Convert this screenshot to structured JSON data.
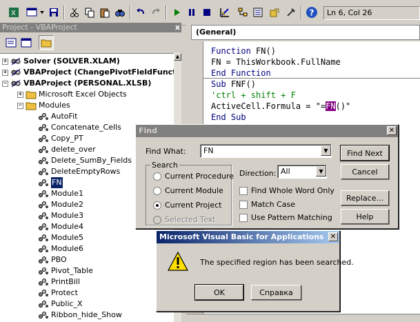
{
  "toolbar": {
    "status": "Ln 6, Col 26"
  },
  "project": {
    "title": "Project - VBAProject",
    "close": "x",
    "tree": [
      {
        "label": "Solver (SOLVER.XLAM)",
        "bold": true,
        "level": 0
      },
      {
        "label": "VBAProject (ChangePivotFieldFunctio",
        "bold": true,
        "level": 0
      },
      {
        "label": "VBAProject (PERSONAL.XLSB)",
        "bold": true,
        "level": 0
      },
      {
        "label": "Microsoft Excel Objects",
        "level": 1
      },
      {
        "label": "Modules",
        "level": 1
      },
      {
        "label": "AutoFit",
        "level": 2
      },
      {
        "label": "Concatenate_Cells",
        "level": 2
      },
      {
        "label": "Copy_PT",
        "level": 2
      },
      {
        "label": "delete_over",
        "level": 2
      },
      {
        "label": "Delete_SumBy_Fields",
        "level": 2
      },
      {
        "label": "DeleteEmptyRows",
        "level": 2
      },
      {
        "label": "FN",
        "level": 2,
        "selected": true
      },
      {
        "label": "Module1",
        "level": 2
      },
      {
        "label": "Module2",
        "level": 2
      },
      {
        "label": "Module3",
        "level": 2
      },
      {
        "label": "Module4",
        "level": 2
      },
      {
        "label": "Module5",
        "level": 2
      },
      {
        "label": "Module6",
        "level": 2
      },
      {
        "label": "PBO",
        "level": 2
      },
      {
        "label": "Pivot_Table",
        "level": 2
      },
      {
        "label": "PrintBill",
        "level": 2
      },
      {
        "label": "Protect",
        "level": 2
      },
      {
        "label": "Public_X",
        "level": 2
      },
      {
        "label": "Ribbon_hide_Show",
        "level": 2
      }
    ]
  },
  "code": {
    "combo": "(General)",
    "line1_kw": "Function",
    "line1_rest": " FN()",
    "line2": "FN = ThisWorkbook.FullName",
    "line3": "End Function",
    "line4_kw": "Sub",
    "line4_rest": " FNF()",
    "line5": "'ctrl + shift + F",
    "line6_pre": "ActiveCell.Formula = \"=",
    "line6_hl": "FN",
    "line6_post": "()\"",
    "line7": "End Sub"
  },
  "find": {
    "title": "Find",
    "find_what_label": "Find What:",
    "find_what_value": "FN",
    "search_label": "Search",
    "opt_current_procedure": "Current Procedure",
    "opt_current_module": "Current Module",
    "opt_current_project": "Current Project",
    "opt_selected_text": "Selected Text",
    "direction_label": "Direction:",
    "direction_value": "All",
    "chk_whole_word": "Find Whole Word Only",
    "chk_match_case": "Match Case",
    "chk_pattern": "Use Pattern Matching",
    "btn_find_next": "Find Next",
    "btn_cancel": "Cancel",
    "btn_replace": "Replace...",
    "btn_help": "Help"
  },
  "msgbox": {
    "title": "Microsoft Visual Basic for Applications",
    "message": "The specified region has been searched.",
    "ok": "OK",
    "help": "Справка"
  },
  "colors": {
    "keyword": "#00007f",
    "comment": "#007f00",
    "highlight": "#800080",
    "selection": "#0a246a"
  }
}
